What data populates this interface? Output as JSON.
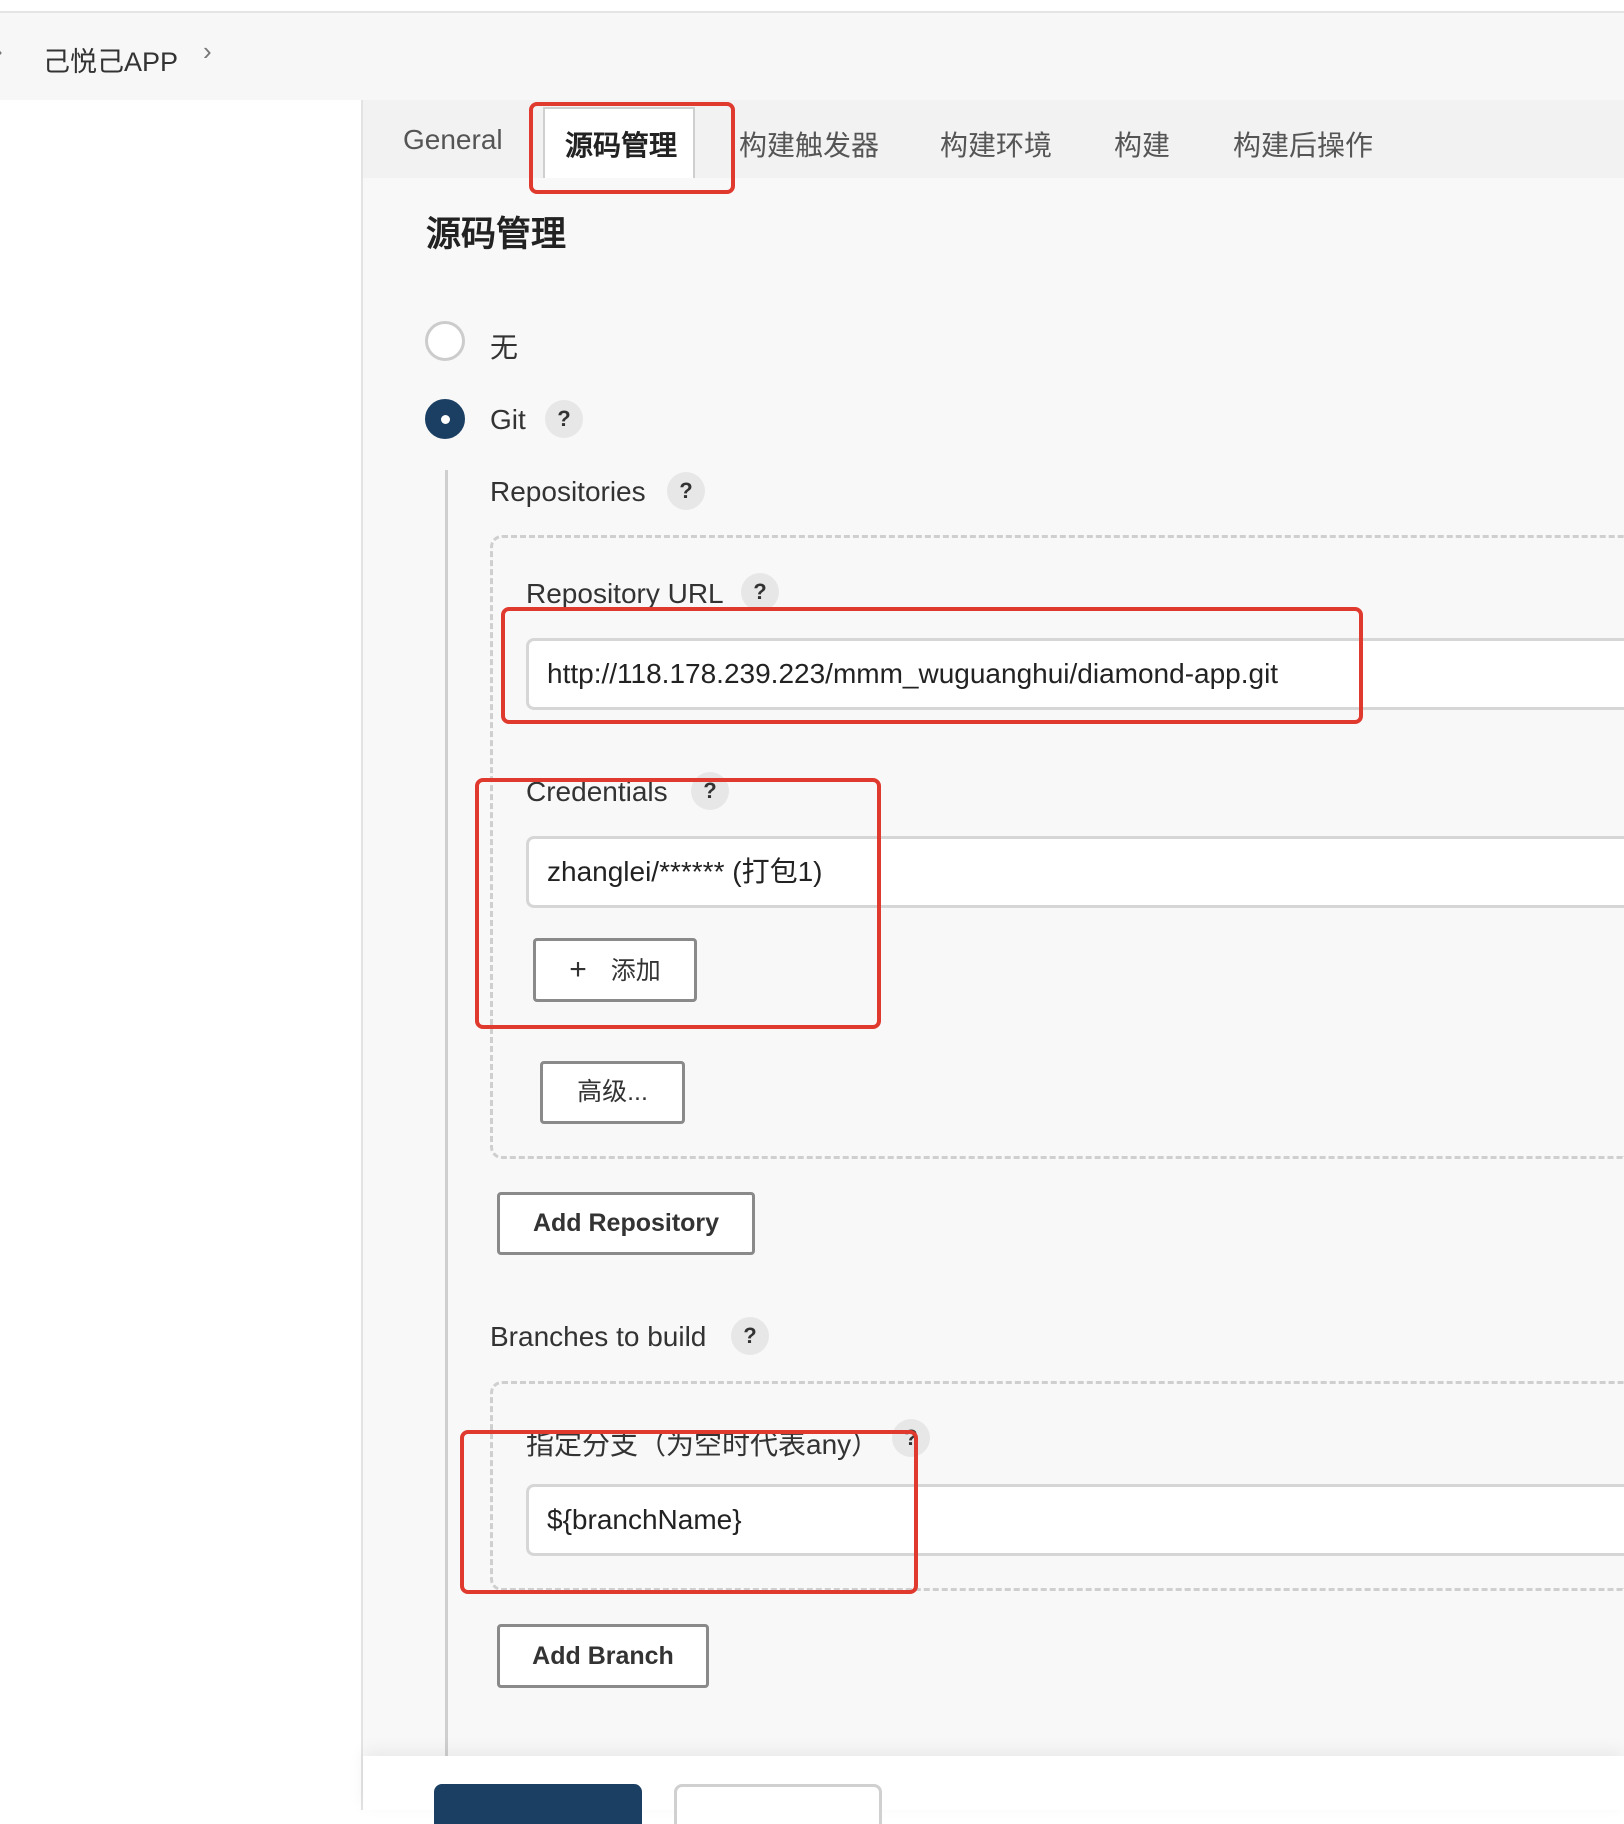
{
  "breadcrumb": {
    "project": "己悦己APP"
  },
  "tabs": [
    {
      "label": "General"
    },
    {
      "label": "源码管理"
    },
    {
      "label": "构建触发器"
    },
    {
      "label": "构建环境"
    },
    {
      "label": "构建"
    },
    {
      "label": "构建后操作"
    }
  ],
  "active_tab": "源码管理",
  "section": {
    "title": "源码管理"
  },
  "scm": {
    "option_none": "无",
    "option_git": "Git",
    "selected": "Git",
    "help_symbol": "?"
  },
  "repositories": {
    "label": "Repositories",
    "url_label": "Repository URL",
    "url_value": "http://118.178.239.223/mmm_wuguanghui/diamond-app.git",
    "credentials_label": "Credentials",
    "credentials_value": "zhanglei/****** (打包1)",
    "add_credentials": "添加",
    "add_credentials_icon": "+",
    "advanced": "高级...",
    "add_repository": "Add Repository"
  },
  "branches": {
    "label": "Branches to build",
    "specifier_label": "指定分支（为空时代表any）",
    "specifier_value": "${branchName}",
    "add_branch": "Add Branch"
  },
  "colors": {
    "accent": "#1b3f63",
    "highlight": "#e03a2f",
    "background": "#f8f8f8"
  }
}
